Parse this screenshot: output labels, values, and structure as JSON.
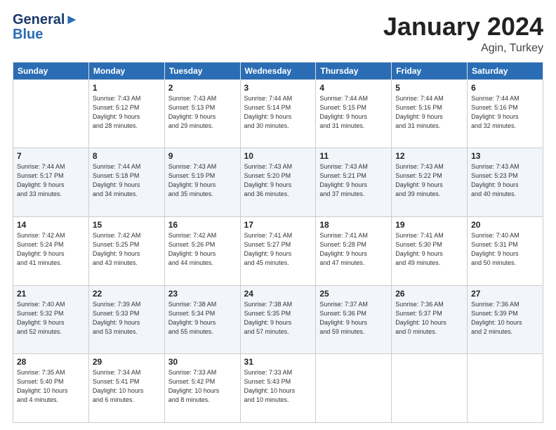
{
  "header": {
    "logo_line1": "General",
    "logo_line2": "Blue",
    "month": "January 2024",
    "location": "Agin, Turkey"
  },
  "weekdays": [
    "Sunday",
    "Monday",
    "Tuesday",
    "Wednesday",
    "Thursday",
    "Friday",
    "Saturday"
  ],
  "weeks": [
    [
      {
        "day": "",
        "info": ""
      },
      {
        "day": "1",
        "info": "Sunrise: 7:43 AM\nSunset: 5:12 PM\nDaylight: 9 hours\nand 28 minutes."
      },
      {
        "day": "2",
        "info": "Sunrise: 7:43 AM\nSunset: 5:13 PM\nDaylight: 9 hours\nand 29 minutes."
      },
      {
        "day": "3",
        "info": "Sunrise: 7:44 AM\nSunset: 5:14 PM\nDaylight: 9 hours\nand 30 minutes."
      },
      {
        "day": "4",
        "info": "Sunrise: 7:44 AM\nSunset: 5:15 PM\nDaylight: 9 hours\nand 31 minutes."
      },
      {
        "day": "5",
        "info": "Sunrise: 7:44 AM\nSunset: 5:16 PM\nDaylight: 9 hours\nand 31 minutes."
      },
      {
        "day": "6",
        "info": "Sunrise: 7:44 AM\nSunset: 5:16 PM\nDaylight: 9 hours\nand 32 minutes."
      }
    ],
    [
      {
        "day": "7",
        "info": "Sunrise: 7:44 AM\nSunset: 5:17 PM\nDaylight: 9 hours\nand 33 minutes."
      },
      {
        "day": "8",
        "info": "Sunrise: 7:44 AM\nSunset: 5:18 PM\nDaylight: 9 hours\nand 34 minutes."
      },
      {
        "day": "9",
        "info": "Sunrise: 7:43 AM\nSunset: 5:19 PM\nDaylight: 9 hours\nand 35 minutes."
      },
      {
        "day": "10",
        "info": "Sunrise: 7:43 AM\nSunset: 5:20 PM\nDaylight: 9 hours\nand 36 minutes."
      },
      {
        "day": "11",
        "info": "Sunrise: 7:43 AM\nSunset: 5:21 PM\nDaylight: 9 hours\nand 37 minutes."
      },
      {
        "day": "12",
        "info": "Sunrise: 7:43 AM\nSunset: 5:22 PM\nDaylight: 9 hours\nand 39 minutes."
      },
      {
        "day": "13",
        "info": "Sunrise: 7:43 AM\nSunset: 5:23 PM\nDaylight: 9 hours\nand 40 minutes."
      }
    ],
    [
      {
        "day": "14",
        "info": "Sunrise: 7:42 AM\nSunset: 5:24 PM\nDaylight: 9 hours\nand 41 minutes."
      },
      {
        "day": "15",
        "info": "Sunrise: 7:42 AM\nSunset: 5:25 PM\nDaylight: 9 hours\nand 43 minutes."
      },
      {
        "day": "16",
        "info": "Sunrise: 7:42 AM\nSunset: 5:26 PM\nDaylight: 9 hours\nand 44 minutes."
      },
      {
        "day": "17",
        "info": "Sunrise: 7:41 AM\nSunset: 5:27 PM\nDaylight: 9 hours\nand 45 minutes."
      },
      {
        "day": "18",
        "info": "Sunrise: 7:41 AM\nSunset: 5:28 PM\nDaylight: 9 hours\nand 47 minutes."
      },
      {
        "day": "19",
        "info": "Sunrise: 7:41 AM\nSunset: 5:30 PM\nDaylight: 9 hours\nand 49 minutes."
      },
      {
        "day": "20",
        "info": "Sunrise: 7:40 AM\nSunset: 5:31 PM\nDaylight: 9 hours\nand 50 minutes."
      }
    ],
    [
      {
        "day": "21",
        "info": "Sunrise: 7:40 AM\nSunset: 5:32 PM\nDaylight: 9 hours\nand 52 minutes."
      },
      {
        "day": "22",
        "info": "Sunrise: 7:39 AM\nSunset: 5:33 PM\nDaylight: 9 hours\nand 53 minutes."
      },
      {
        "day": "23",
        "info": "Sunrise: 7:38 AM\nSunset: 5:34 PM\nDaylight: 9 hours\nand 55 minutes."
      },
      {
        "day": "24",
        "info": "Sunrise: 7:38 AM\nSunset: 5:35 PM\nDaylight: 9 hours\nand 57 minutes."
      },
      {
        "day": "25",
        "info": "Sunrise: 7:37 AM\nSunset: 5:36 PM\nDaylight: 9 hours\nand 59 minutes."
      },
      {
        "day": "26",
        "info": "Sunrise: 7:36 AM\nSunset: 5:37 PM\nDaylight: 10 hours\nand 0 minutes."
      },
      {
        "day": "27",
        "info": "Sunrise: 7:36 AM\nSunset: 5:39 PM\nDaylight: 10 hours\nand 2 minutes."
      }
    ],
    [
      {
        "day": "28",
        "info": "Sunrise: 7:35 AM\nSunset: 5:40 PM\nDaylight: 10 hours\nand 4 minutes."
      },
      {
        "day": "29",
        "info": "Sunrise: 7:34 AM\nSunset: 5:41 PM\nDaylight: 10 hours\nand 6 minutes."
      },
      {
        "day": "30",
        "info": "Sunrise: 7:33 AM\nSunset: 5:42 PM\nDaylight: 10 hours\nand 8 minutes."
      },
      {
        "day": "31",
        "info": "Sunrise: 7:33 AM\nSunset: 5:43 PM\nDaylight: 10 hours\nand 10 minutes."
      },
      {
        "day": "",
        "info": ""
      },
      {
        "day": "",
        "info": ""
      },
      {
        "day": "",
        "info": ""
      }
    ]
  ]
}
